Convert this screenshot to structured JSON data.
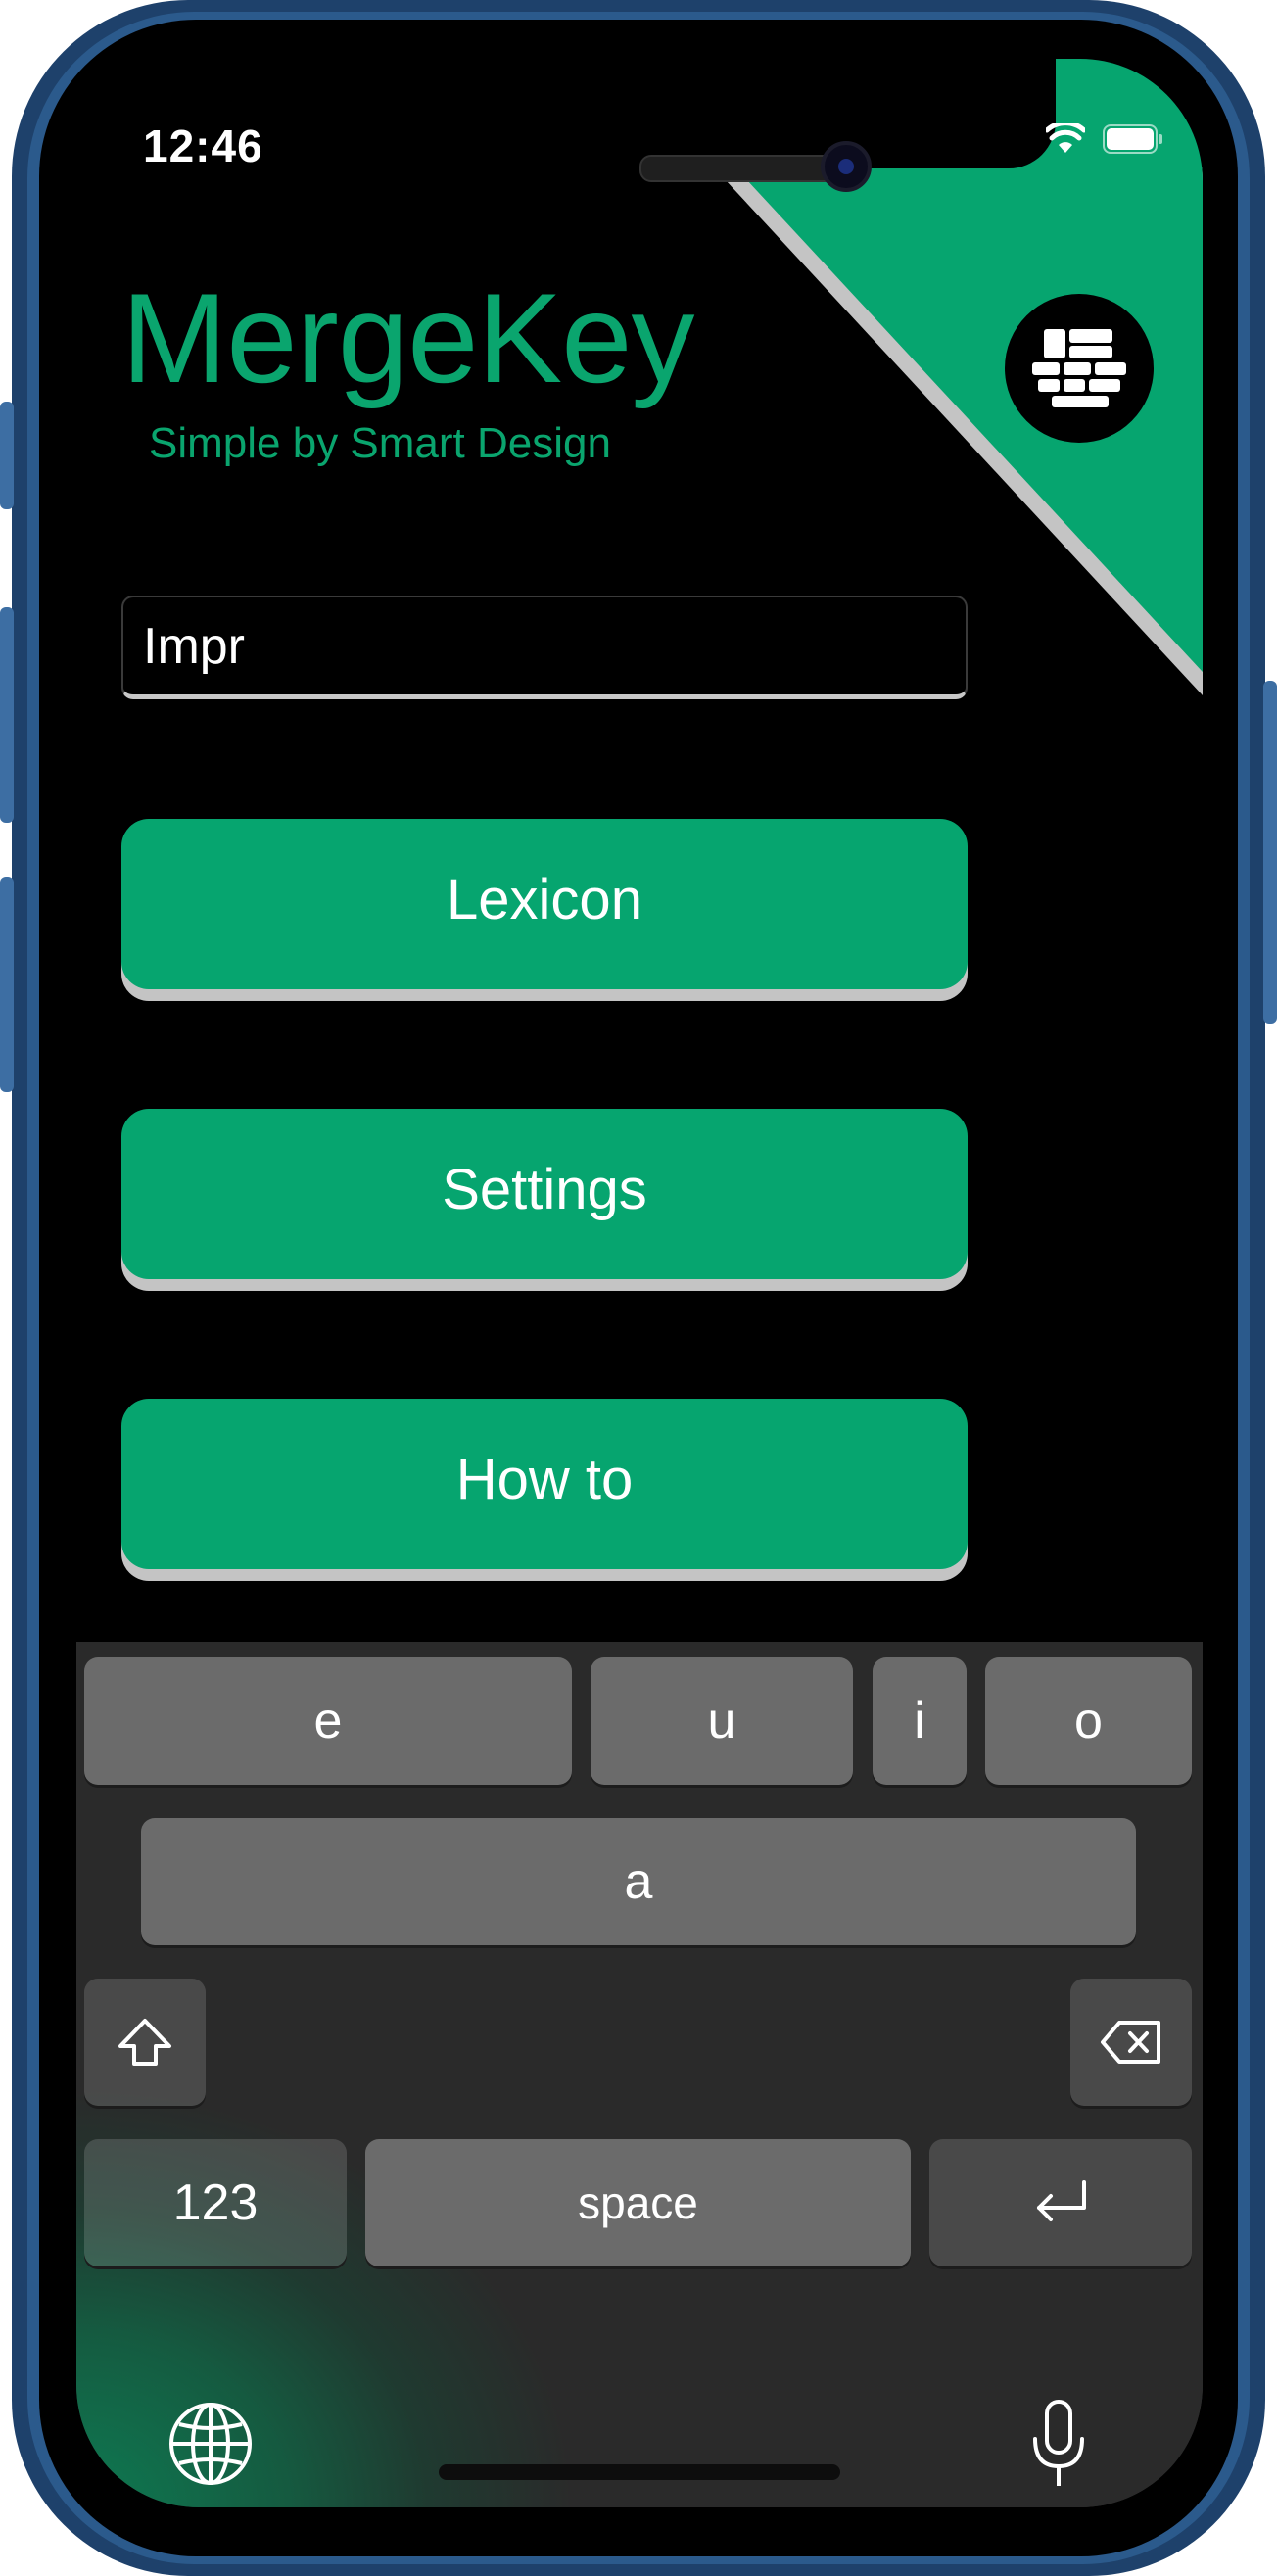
{
  "status_bar": {
    "time": "12:46",
    "icons": [
      "wifi-icon",
      "battery-icon"
    ]
  },
  "header": {
    "title": "MergeKey",
    "subtitle": "Simple by Smart Design",
    "logo_icon": "keyboard-grid-icon"
  },
  "search": {
    "value": "Impr"
  },
  "buttons": {
    "lexicon": "Lexicon",
    "settings": "Settings",
    "how_to": "How to"
  },
  "keyboard": {
    "row1": [
      "e",
      "u",
      "i",
      "o"
    ],
    "row2": [
      "a"
    ],
    "shift_icon": "shift-icon",
    "delete_icon": "backspace-icon",
    "numbers": "123",
    "space": "space",
    "return_icon": "return-icon",
    "globe_icon": "globe-icon",
    "mic_icon": "microphone-icon"
  },
  "colors": {
    "accent": "#06a56f",
    "background": "#000000",
    "frame": "#1e416b"
  }
}
